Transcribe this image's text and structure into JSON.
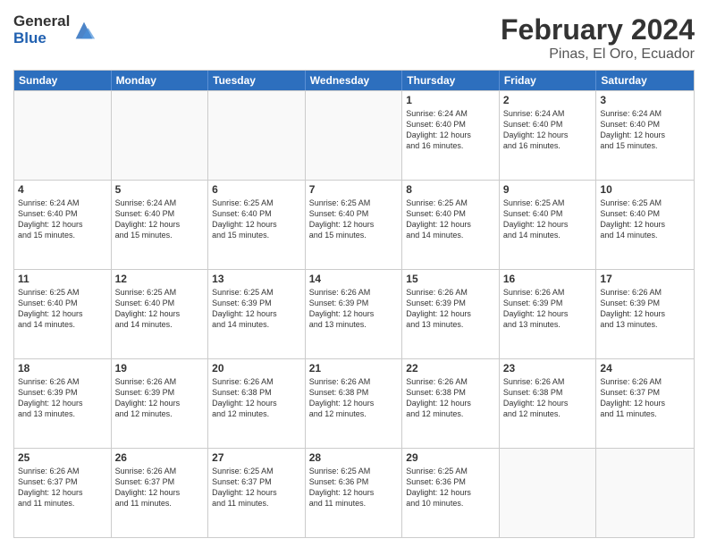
{
  "logo": {
    "text_general": "General",
    "text_blue": "Blue"
  },
  "title": {
    "month_year": "February 2024",
    "location": "Pinas, El Oro, Ecuador"
  },
  "header_days": [
    "Sunday",
    "Monday",
    "Tuesday",
    "Wednesday",
    "Thursday",
    "Friday",
    "Saturday"
  ],
  "weeks": [
    [
      {
        "day": "",
        "info": ""
      },
      {
        "day": "",
        "info": ""
      },
      {
        "day": "",
        "info": ""
      },
      {
        "day": "",
        "info": ""
      },
      {
        "day": "1",
        "info": "Sunrise: 6:24 AM\nSunset: 6:40 PM\nDaylight: 12 hours\nand 16 minutes."
      },
      {
        "day": "2",
        "info": "Sunrise: 6:24 AM\nSunset: 6:40 PM\nDaylight: 12 hours\nand 16 minutes."
      },
      {
        "day": "3",
        "info": "Sunrise: 6:24 AM\nSunset: 6:40 PM\nDaylight: 12 hours\nand 15 minutes."
      }
    ],
    [
      {
        "day": "4",
        "info": "Sunrise: 6:24 AM\nSunset: 6:40 PM\nDaylight: 12 hours\nand 15 minutes."
      },
      {
        "day": "5",
        "info": "Sunrise: 6:24 AM\nSunset: 6:40 PM\nDaylight: 12 hours\nand 15 minutes."
      },
      {
        "day": "6",
        "info": "Sunrise: 6:25 AM\nSunset: 6:40 PM\nDaylight: 12 hours\nand 15 minutes."
      },
      {
        "day": "7",
        "info": "Sunrise: 6:25 AM\nSunset: 6:40 PM\nDaylight: 12 hours\nand 15 minutes."
      },
      {
        "day": "8",
        "info": "Sunrise: 6:25 AM\nSunset: 6:40 PM\nDaylight: 12 hours\nand 14 minutes."
      },
      {
        "day": "9",
        "info": "Sunrise: 6:25 AM\nSunset: 6:40 PM\nDaylight: 12 hours\nand 14 minutes."
      },
      {
        "day": "10",
        "info": "Sunrise: 6:25 AM\nSunset: 6:40 PM\nDaylight: 12 hours\nand 14 minutes."
      }
    ],
    [
      {
        "day": "11",
        "info": "Sunrise: 6:25 AM\nSunset: 6:40 PM\nDaylight: 12 hours\nand 14 minutes."
      },
      {
        "day": "12",
        "info": "Sunrise: 6:25 AM\nSunset: 6:40 PM\nDaylight: 12 hours\nand 14 minutes."
      },
      {
        "day": "13",
        "info": "Sunrise: 6:25 AM\nSunset: 6:39 PM\nDaylight: 12 hours\nand 14 minutes."
      },
      {
        "day": "14",
        "info": "Sunrise: 6:26 AM\nSunset: 6:39 PM\nDaylight: 12 hours\nand 13 minutes."
      },
      {
        "day": "15",
        "info": "Sunrise: 6:26 AM\nSunset: 6:39 PM\nDaylight: 12 hours\nand 13 minutes."
      },
      {
        "day": "16",
        "info": "Sunrise: 6:26 AM\nSunset: 6:39 PM\nDaylight: 12 hours\nand 13 minutes."
      },
      {
        "day": "17",
        "info": "Sunrise: 6:26 AM\nSunset: 6:39 PM\nDaylight: 12 hours\nand 13 minutes."
      }
    ],
    [
      {
        "day": "18",
        "info": "Sunrise: 6:26 AM\nSunset: 6:39 PM\nDaylight: 12 hours\nand 13 minutes."
      },
      {
        "day": "19",
        "info": "Sunrise: 6:26 AM\nSunset: 6:39 PM\nDaylight: 12 hours\nand 12 minutes."
      },
      {
        "day": "20",
        "info": "Sunrise: 6:26 AM\nSunset: 6:38 PM\nDaylight: 12 hours\nand 12 minutes."
      },
      {
        "day": "21",
        "info": "Sunrise: 6:26 AM\nSunset: 6:38 PM\nDaylight: 12 hours\nand 12 minutes."
      },
      {
        "day": "22",
        "info": "Sunrise: 6:26 AM\nSunset: 6:38 PM\nDaylight: 12 hours\nand 12 minutes."
      },
      {
        "day": "23",
        "info": "Sunrise: 6:26 AM\nSunset: 6:38 PM\nDaylight: 12 hours\nand 12 minutes."
      },
      {
        "day": "24",
        "info": "Sunrise: 6:26 AM\nSunset: 6:37 PM\nDaylight: 12 hours\nand 11 minutes."
      }
    ],
    [
      {
        "day": "25",
        "info": "Sunrise: 6:26 AM\nSunset: 6:37 PM\nDaylight: 12 hours\nand 11 minutes."
      },
      {
        "day": "26",
        "info": "Sunrise: 6:26 AM\nSunset: 6:37 PM\nDaylight: 12 hours\nand 11 minutes."
      },
      {
        "day": "27",
        "info": "Sunrise: 6:25 AM\nSunset: 6:37 PM\nDaylight: 12 hours\nand 11 minutes."
      },
      {
        "day": "28",
        "info": "Sunrise: 6:25 AM\nSunset: 6:36 PM\nDaylight: 12 hours\nand 11 minutes."
      },
      {
        "day": "29",
        "info": "Sunrise: 6:25 AM\nSunset: 6:36 PM\nDaylight: 12 hours\nand 10 minutes."
      },
      {
        "day": "",
        "info": ""
      },
      {
        "day": "",
        "info": ""
      }
    ]
  ]
}
